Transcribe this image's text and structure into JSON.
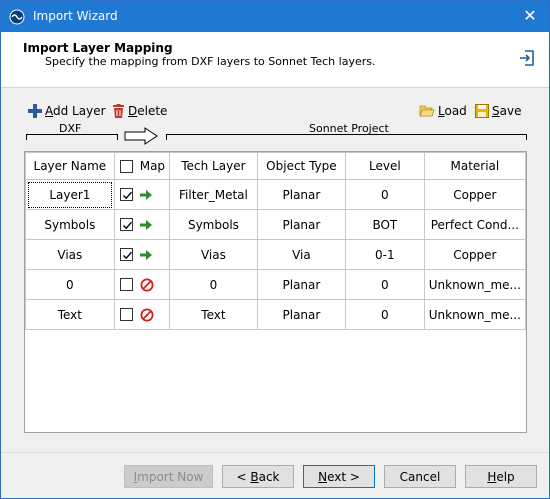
{
  "window": {
    "title": "Import Wizard",
    "close_glyph": "✕"
  },
  "header": {
    "title": "Import Layer Mapping",
    "subtitle": "Specify the mapping from DXF layers to Sonnet Tech layers."
  },
  "toolbar": {
    "add_layer_accel": "A",
    "add_layer_rest": "dd Layer",
    "delete_accel": "D",
    "delete_rest": "elete",
    "load_accel": "L",
    "load_rest": "oad",
    "save_accel": "S",
    "save_rest": "ave"
  },
  "groups": {
    "dxf": "DXF",
    "sonnet": "Sonnet Project"
  },
  "columns": {
    "layer_name": "Layer Name",
    "map": "Map",
    "tech_layer": "Tech Layer",
    "object_type": "Object Type",
    "level": "Level",
    "material": "Material"
  },
  "rows": [
    {
      "layer_name": "Layer1",
      "mapped": true,
      "tech_layer": "Filter_Metal",
      "object_type": "Planar",
      "level": "0",
      "material": "Copper"
    },
    {
      "layer_name": "Symbols",
      "mapped": true,
      "tech_layer": "Symbols",
      "object_type": "Planar",
      "level": "BOT",
      "material": "Perfect Cond..."
    },
    {
      "layer_name": "Vias",
      "mapped": true,
      "tech_layer": "Vias",
      "object_type": "Via",
      "level": "0-1",
      "material": "Copper"
    },
    {
      "layer_name": "0",
      "mapped": false,
      "tech_layer": "0",
      "object_type": "Planar",
      "level": "0",
      "material": "Unknown_me..."
    },
    {
      "layer_name": "Text",
      "mapped": false,
      "tech_layer": "Text",
      "object_type": "Planar",
      "level": "0",
      "material": "Unknown_me..."
    }
  ],
  "buttons": {
    "import_now_accel": "I",
    "import_now_rest": "mport Now",
    "back_prefix": "< ",
    "back_accel": "B",
    "back_rest": "ack",
    "next_accel": "N",
    "next_rest": "ext >",
    "cancel": "Cancel",
    "help_accel": "H",
    "help_rest": "elp"
  },
  "colors": {
    "titlebar": "#1f78d1",
    "map_arrow": "#2e8b2e",
    "no_map": "#d42020",
    "add_icon": "#2c5aa0",
    "delete_icon": "#c0392b"
  }
}
